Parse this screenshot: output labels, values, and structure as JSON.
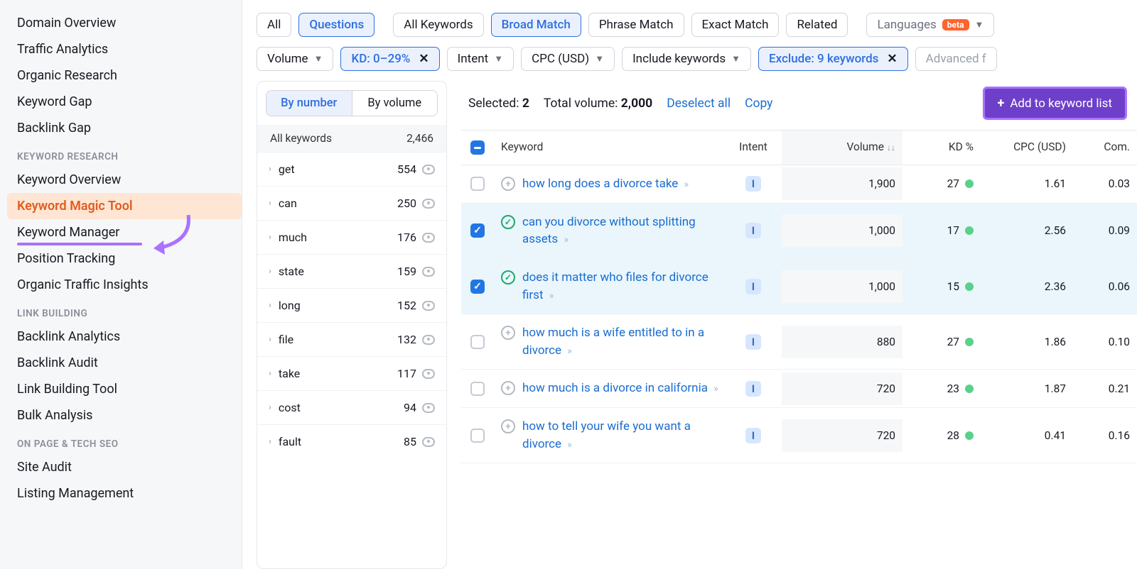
{
  "sidebar": {
    "group0": [
      "Domain Overview",
      "Traffic Analytics",
      "Organic Research",
      "Keyword Gap",
      "Backlink Gap"
    ],
    "heading1": "KEYWORD RESEARCH",
    "group1": [
      "Keyword Overview",
      "Keyword Magic Tool",
      "Keyword Manager",
      "Position Tracking",
      "Organic Traffic Insights"
    ],
    "heading2": "LINK BUILDING",
    "group2": [
      "Backlink Analytics",
      "Backlink Audit",
      "Link Building Tool",
      "Bulk Analysis"
    ],
    "heading3": "ON PAGE & TECH SEO",
    "group3": [
      "Site Audit",
      "Listing Management"
    ]
  },
  "filters": {
    "type": {
      "all": "All",
      "questions": "Questions"
    },
    "match": [
      "All Keywords",
      "Broad Match",
      "Phrase Match",
      "Exact Match",
      "Related"
    ],
    "lang": "Languages",
    "beta": "beta",
    "row2": {
      "volume": "Volume",
      "kd": "KD: 0–29%",
      "intent": "Intent",
      "cpc": "CPC (USD)",
      "include": "Include keywords",
      "exclude": "Exclude: 9 keywords",
      "advanced": "Advanced f"
    }
  },
  "groups": {
    "seg": {
      "num": "By number",
      "vol": "By volume"
    },
    "header": {
      "label": "All keywords",
      "count": "2,466"
    },
    "items": [
      {
        "label": "get",
        "count": "554"
      },
      {
        "label": "can",
        "count": "250"
      },
      {
        "label": "much",
        "count": "176"
      },
      {
        "label": "state",
        "count": "159"
      },
      {
        "label": "long",
        "count": "152"
      },
      {
        "label": "file",
        "count": "132"
      },
      {
        "label": "take",
        "count": "117"
      },
      {
        "label": "cost",
        "count": "94"
      },
      {
        "label": "fault",
        "count": "85"
      }
    ]
  },
  "toolbar": {
    "selected_label": "Selected:",
    "selected_count": "2",
    "total_label": "Total volume:",
    "total_value": "2,000",
    "deselect": "Deselect all",
    "copy": "Copy",
    "add": "Add to keyword list"
  },
  "table": {
    "headers": {
      "kw": "Keyword",
      "intent": "Intent",
      "vol": "Volume",
      "kd": "KD %",
      "cpc": "CPC (USD)",
      "com": "Com."
    },
    "rows": [
      {
        "sel": false,
        "added": false,
        "kw": "how long does a divorce take",
        "intent": "I",
        "vol": "1,900",
        "kd": "27",
        "cpc": "1.61",
        "com": "0.03"
      },
      {
        "sel": true,
        "added": true,
        "kw": "can you divorce without splitting assets",
        "intent": "I",
        "vol": "1,000",
        "kd": "17",
        "cpc": "2.56",
        "com": "0.09"
      },
      {
        "sel": true,
        "added": true,
        "kw": "does it matter who files for divorce first",
        "intent": "I",
        "vol": "1,000",
        "kd": "15",
        "cpc": "2.36",
        "com": "0.06"
      },
      {
        "sel": false,
        "added": false,
        "kw": "how much is a wife entitled to in a divorce",
        "intent": "I",
        "vol": "880",
        "kd": "27",
        "cpc": "1.86",
        "com": "0.10"
      },
      {
        "sel": false,
        "added": false,
        "kw": "how much is a divorce in california",
        "intent": "I",
        "vol": "720",
        "kd": "23",
        "cpc": "1.87",
        "com": "0.21"
      },
      {
        "sel": false,
        "added": false,
        "kw": "how to tell your wife you want a divorce",
        "intent": "I",
        "vol": "720",
        "kd": "28",
        "cpc": "0.41",
        "com": "0.16"
      }
    ]
  }
}
